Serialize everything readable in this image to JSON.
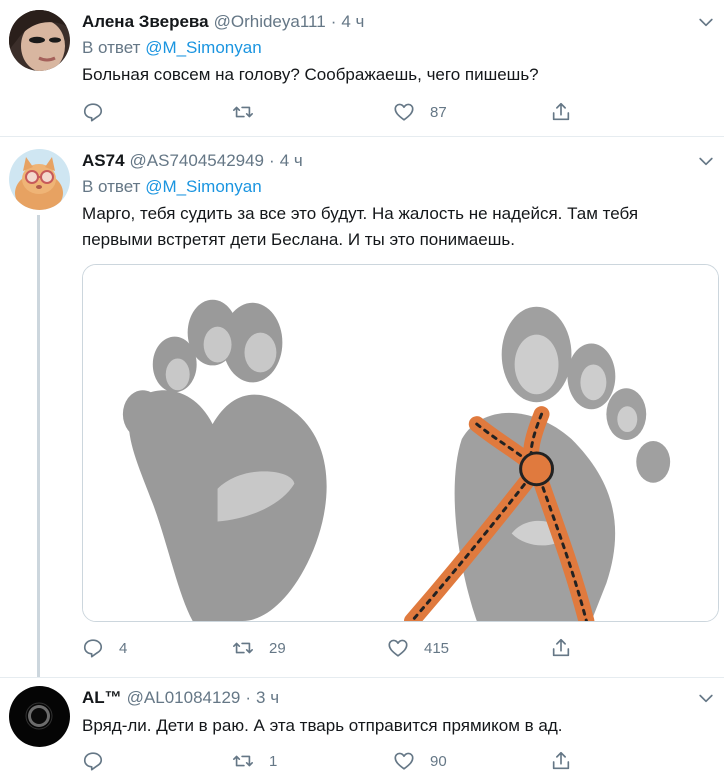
{
  "tweets": [
    {
      "name": "Алена Зверева",
      "handle": "@Orhideya111",
      "dot": "·",
      "time": "4 ч",
      "reply_prefix": "В ответ",
      "reply_mention": "@M_Simonyan",
      "text": "Больная совсем на голову? Соображаешь, чего пишешь?",
      "reply_count": "",
      "retweet_count": "",
      "like_count": "87"
    },
    {
      "name": "AS74",
      "handle": "@AS7404542949",
      "dot": "·",
      "time": "4 ч",
      "reply_prefix": "В ответ",
      "reply_mention": "@M_Simonyan",
      "text_line1": "Марго, тебя судить за все это будут. На жалость не надейся. Там тебя",
      "text_line2": "первыми встретят дети Беслана. И ты это понимаешь.",
      "reply_count": "4",
      "retweet_count": "29",
      "like_count": "415"
    },
    {
      "name": "AL™",
      "handle": "@AL01084129",
      "dot": "·",
      "time": "3 ч",
      "text": "Вряд-ли. Дети в раю. А эта тварь отправится прямиком в ад.",
      "reply_count": "",
      "retweet_count": "1",
      "like_count": "90"
    }
  ],
  "icons": {
    "reply": "reply-icon",
    "retweet": "retweet-icon",
    "like": "heart-icon",
    "share": "share-icon",
    "more": "chevron-down-icon"
  },
  "colors": {
    "link": "#1b95e0",
    "secondary_text": "#657786",
    "divider": "#e6ecf0",
    "thread_line": "#ccd6dd"
  }
}
